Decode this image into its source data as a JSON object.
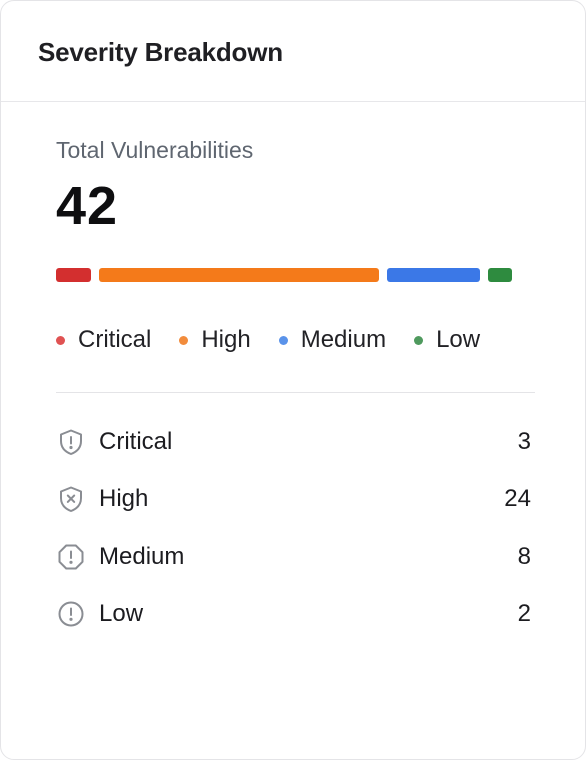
{
  "card": {
    "title": "Severity Breakdown"
  },
  "summary": {
    "total_label": "Total Vulnerabilities",
    "total_value": "42"
  },
  "severity_bar": {
    "segments": [
      {
        "name": "Critical",
        "count": 3,
        "color": "#d32f2f"
      },
      {
        "name": "High",
        "count": 24,
        "color": "#f47a1a"
      },
      {
        "name": "Medium",
        "count": 8,
        "color": "#3b78e7"
      },
      {
        "name": "Low",
        "count": 2,
        "color": "#2e8b3f"
      }
    ]
  },
  "legend": {
    "items": [
      {
        "label": "Critical",
        "color": "#e05252"
      },
      {
        "label": "High",
        "color": "#f28c3c"
      },
      {
        "label": "Medium",
        "color": "#5a93ea"
      },
      {
        "label": "Low",
        "color": "#4f9a5e"
      }
    ]
  },
  "rows": [
    {
      "label": "Critical",
      "count": "3",
      "icon": "shield-alert-icon"
    },
    {
      "label": "High",
      "count": "24",
      "icon": "shield-x-icon"
    },
    {
      "label": "Medium",
      "count": "8",
      "icon": "octagon-alert-icon"
    },
    {
      "label": "Low",
      "count": "2",
      "icon": "circle-alert-icon"
    }
  ],
  "colors": {
    "icon_stroke": "#8a8d93",
    "divider": "#e4e4e7"
  }
}
